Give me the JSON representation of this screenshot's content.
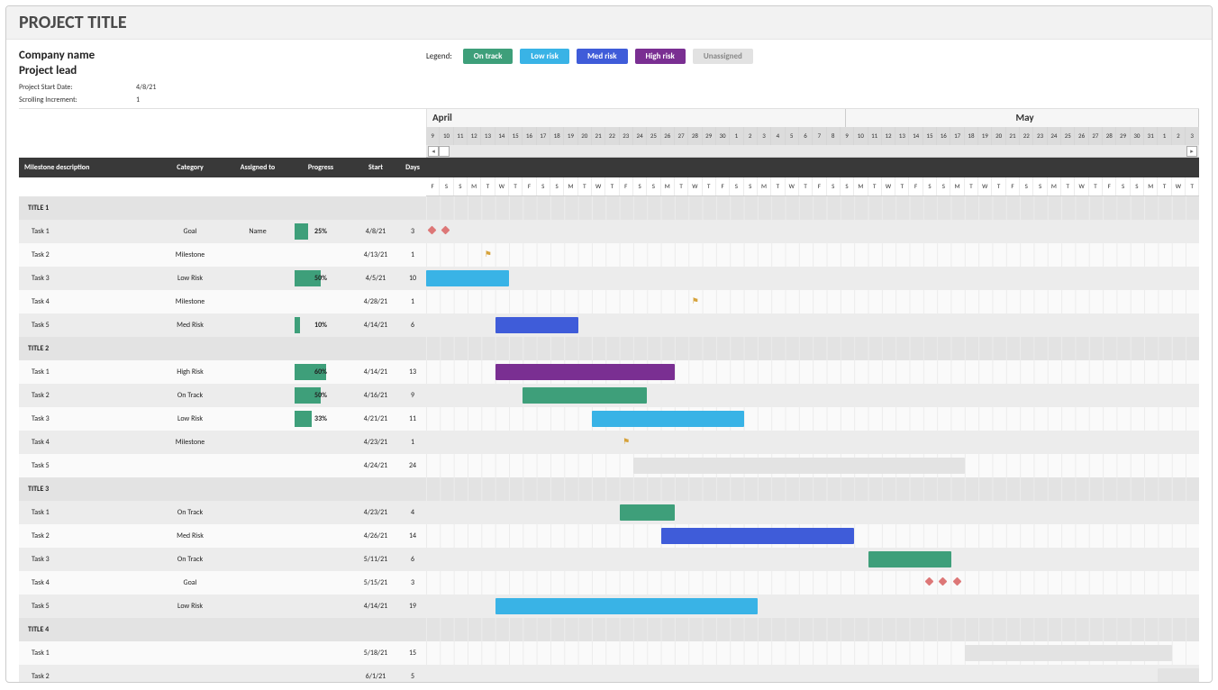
{
  "title": "PROJECT TITLE",
  "company": "Company name",
  "lead": "Project lead",
  "meta": {
    "start_date_label": "Project Start Date:",
    "start_date": "4/8/21",
    "scroll_label": "Scrolling Increment:",
    "scroll": "1"
  },
  "legend": {
    "label": "Legend:",
    "items": [
      {
        "label": "On track",
        "class": "on"
      },
      {
        "label": "Low risk",
        "class": "low"
      },
      {
        "label": "Med risk",
        "class": "med"
      },
      {
        "label": "High risk",
        "class": "high"
      },
      {
        "label": "Unassigned",
        "class": "una"
      }
    ]
  },
  "timeline": {
    "months": [
      {
        "label": "April",
        "days": 22
      },
      {
        "label": "May",
        "days": 31
      }
    ],
    "start_day_num": 9,
    "day_nums": [
      9,
      10,
      11,
      12,
      13,
      14,
      15,
      16,
      17,
      18,
      19,
      20,
      21,
      22,
      23,
      24,
      25,
      26,
      27,
      28,
      29,
      30,
      1,
      2,
      3,
      4,
      5,
      6,
      7,
      8,
      9,
      10,
      11,
      12,
      13,
      14,
      15,
      16,
      17,
      18,
      19,
      20,
      21,
      22,
      23,
      24,
      25,
      26,
      27,
      28,
      29,
      30,
      31,
      1,
      2,
      3
    ],
    "day_lets": [
      "F",
      "S",
      "S",
      "M",
      "T",
      "W",
      "T",
      "F",
      "S",
      "S",
      "M",
      "T",
      "W",
      "T",
      "F",
      "S",
      "S",
      "M",
      "T",
      "W",
      "T",
      "F",
      "S",
      "S",
      "M",
      "T",
      "W",
      "T",
      "F",
      "S",
      "S",
      "M",
      "T",
      "W",
      "T",
      "F",
      "S",
      "S",
      "M",
      "T",
      "W",
      "T",
      "F",
      "S",
      "S",
      "M",
      "T",
      "W",
      "T",
      "F",
      "S",
      "S",
      "M",
      "T",
      "W",
      "T"
    ]
  },
  "columns": {
    "desc": "Milestone description",
    "cat": "Category",
    "asg": "Assigned to",
    "prog": "Progress",
    "start": "Start",
    "days": "Days"
  },
  "rows": [
    {
      "type": "section",
      "desc": "TITLE 1"
    },
    {
      "type": "task",
      "desc": "Task 1",
      "cat": "Goal",
      "asg": "Name",
      "prog": 25,
      "start": "4/8/21",
      "days": 3,
      "bar": null,
      "markers": [
        {
          "kind": "diamond",
          "col": 0
        },
        {
          "kind": "diamond",
          "col": 1
        }
      ]
    },
    {
      "type": "task",
      "desc": "Task 2",
      "cat": "Milestone",
      "asg": "",
      "prog": null,
      "start": "4/13/21",
      "days": 1,
      "bar": null,
      "markers": [
        {
          "kind": "flag",
          "col": 4
        }
      ]
    },
    {
      "type": "task",
      "desc": "Task 3",
      "cat": "Low Risk",
      "asg": "",
      "prog": 50,
      "start": "4/5/21",
      "days": 10,
      "bar": {
        "start": 0,
        "span": 6,
        "class": "low"
      }
    },
    {
      "type": "task",
      "desc": "Task 4",
      "cat": "Milestone",
      "asg": "",
      "prog": null,
      "start": "4/28/21",
      "days": 1,
      "bar": null,
      "markers": [
        {
          "kind": "flag",
          "col": 19
        }
      ]
    },
    {
      "type": "task",
      "desc": "Task 5",
      "cat": "Med Risk",
      "asg": "",
      "prog": 10,
      "start": "4/14/21",
      "days": 6,
      "bar": {
        "start": 5,
        "span": 6,
        "class": "med"
      }
    },
    {
      "type": "section",
      "desc": "TITLE 2"
    },
    {
      "type": "task",
      "desc": "Task 1",
      "cat": "High Risk",
      "asg": "",
      "prog": 60,
      "start": "4/14/21",
      "days": 13,
      "bar": {
        "start": 5,
        "span": 13,
        "class": "high"
      }
    },
    {
      "type": "task",
      "desc": "Task 2",
      "cat": "On Track",
      "asg": "",
      "prog": 50,
      "start": "4/16/21",
      "days": 9,
      "bar": {
        "start": 7,
        "span": 9,
        "class": "on"
      }
    },
    {
      "type": "task",
      "desc": "Task 3",
      "cat": "Low Risk",
      "asg": "",
      "prog": 33,
      "start": "4/21/21",
      "days": 11,
      "bar": {
        "start": 12,
        "span": 11,
        "class": "low"
      }
    },
    {
      "type": "task",
      "desc": "Task 4",
      "cat": "Milestone",
      "asg": "",
      "prog": null,
      "start": "4/23/21",
      "days": 1,
      "bar": null,
      "markers": [
        {
          "kind": "flag",
          "col": 14
        }
      ]
    },
    {
      "type": "task",
      "desc": "Task 5",
      "cat": "",
      "asg": "",
      "prog": null,
      "start": "4/24/21",
      "days": 24,
      "bar": {
        "start": 15,
        "span": 24,
        "class": "una"
      }
    },
    {
      "type": "section",
      "desc": "TITLE 3"
    },
    {
      "type": "task",
      "desc": "Task 1",
      "cat": "On Track",
      "asg": "",
      "prog": null,
      "start": "4/23/21",
      "days": 4,
      "bar": {
        "start": 14,
        "span": 4,
        "class": "on"
      }
    },
    {
      "type": "task",
      "desc": "Task 2",
      "cat": "Med Risk",
      "asg": "",
      "prog": null,
      "start": "4/26/21",
      "days": 14,
      "bar": {
        "start": 17,
        "span": 14,
        "class": "med"
      }
    },
    {
      "type": "task",
      "desc": "Task 3",
      "cat": "On Track",
      "asg": "",
      "prog": null,
      "start": "5/11/21",
      "days": 6,
      "bar": {
        "start": 32,
        "span": 6,
        "class": "on"
      }
    },
    {
      "type": "task",
      "desc": "Task 4",
      "cat": "Goal",
      "asg": "",
      "prog": null,
      "start": "5/15/21",
      "days": 3,
      "bar": null,
      "markers": [
        {
          "kind": "diamond",
          "col": 36
        },
        {
          "kind": "diamond",
          "col": 37
        },
        {
          "kind": "diamond",
          "col": 38
        }
      ]
    },
    {
      "type": "task",
      "desc": "Task 5",
      "cat": "Low Risk",
      "asg": "",
      "prog": null,
      "start": "4/14/21",
      "days": 19,
      "bar": {
        "start": 5,
        "span": 19,
        "class": "low"
      }
    },
    {
      "type": "section",
      "desc": "TITLE 4"
    },
    {
      "type": "task",
      "desc": "Task 1",
      "cat": "",
      "asg": "",
      "prog": null,
      "start": "5/18/21",
      "days": 15,
      "bar": {
        "start": 39,
        "span": 15,
        "class": "una"
      }
    },
    {
      "type": "task",
      "desc": "Task 2",
      "cat": "",
      "asg": "",
      "prog": null,
      "start": "6/1/21",
      "days": 5,
      "bar": {
        "start": 53,
        "span": 3,
        "class": "una"
      }
    }
  ],
  "chart_data": {
    "type": "gantt",
    "title": "PROJECT TITLE",
    "timeline_start": "4/9/21",
    "timeline_days": 56,
    "sections": [
      {
        "name": "TITLE 1",
        "tasks": [
          {
            "name": "Task 1",
            "category": "Goal",
            "assigned": "Name",
            "progress": 25,
            "start": "4/8/21",
            "days": 3
          },
          {
            "name": "Task 2",
            "category": "Milestone",
            "start": "4/13/21",
            "days": 1
          },
          {
            "name": "Task 3",
            "category": "Low Risk",
            "progress": 50,
            "start": "4/5/21",
            "days": 10
          },
          {
            "name": "Task 4",
            "category": "Milestone",
            "start": "4/28/21",
            "days": 1
          },
          {
            "name": "Task 5",
            "category": "Med Risk",
            "progress": 10,
            "start": "4/14/21",
            "days": 6
          }
        ]
      },
      {
        "name": "TITLE 2",
        "tasks": [
          {
            "name": "Task 1",
            "category": "High Risk",
            "progress": 60,
            "start": "4/14/21",
            "days": 13
          },
          {
            "name": "Task 2",
            "category": "On Track",
            "progress": 50,
            "start": "4/16/21",
            "days": 9
          },
          {
            "name": "Task 3",
            "category": "Low Risk",
            "progress": 33,
            "start": "4/21/21",
            "days": 11
          },
          {
            "name": "Task 4",
            "category": "Milestone",
            "start": "4/23/21",
            "days": 1
          },
          {
            "name": "Task 5",
            "category": "Unassigned",
            "start": "4/24/21",
            "days": 24
          }
        ]
      },
      {
        "name": "TITLE 3",
        "tasks": [
          {
            "name": "Task 1",
            "category": "On Track",
            "start": "4/23/21",
            "days": 4
          },
          {
            "name": "Task 2",
            "category": "Med Risk",
            "start": "4/26/21",
            "days": 14
          },
          {
            "name": "Task 3",
            "category": "On Track",
            "start": "5/11/21",
            "days": 6
          },
          {
            "name": "Task 4",
            "category": "Goal",
            "start": "5/15/21",
            "days": 3
          },
          {
            "name": "Task 5",
            "category": "Low Risk",
            "start": "4/14/21",
            "days": 19
          }
        ]
      },
      {
        "name": "TITLE 4",
        "tasks": [
          {
            "name": "Task 1",
            "category": "Unassigned",
            "start": "5/18/21",
            "days": 15
          },
          {
            "name": "Task 2",
            "category": "Unassigned",
            "start": "6/1/21",
            "days": 5
          }
        ]
      }
    ]
  }
}
